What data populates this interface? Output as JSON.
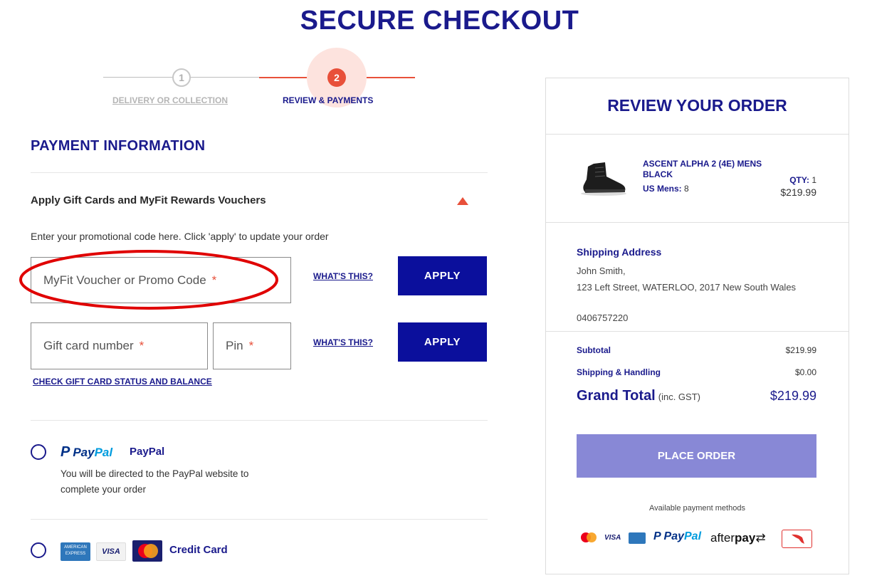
{
  "page": {
    "title": "SECURE CHECKOUT"
  },
  "stepper": {
    "step1": {
      "number": "1",
      "label": "DELIVERY OR COLLECTION"
    },
    "step2": {
      "number": "2",
      "label": "REVIEW & PAYMENTS"
    }
  },
  "payment": {
    "title": "PAYMENT INFORMATION",
    "gift_section_title": "Apply Gift Cards and MyFit Rewards Vouchers",
    "instructions": "Enter your promotional code here. Click 'apply' to update your order",
    "promo_placeholder": "MyFit Voucher or Promo Code",
    "gift_placeholder": "Gift card number",
    "pin_placeholder": "Pin",
    "required_mark": "*",
    "whats_this": "WHAT'S THIS?",
    "apply_label": "APPLY",
    "gift_status_link": "CHECK GIFT CARD STATUS AND BALANCE",
    "paypal": {
      "logo_p": "P",
      "logo_pay": "Pay",
      "logo_pal": "Pal",
      "title": "PayPal",
      "description": "You will be directed to the PayPal website to complete your order"
    },
    "credit_card": {
      "title": "Credit Card",
      "amex_text": "AMERICAN EXPRESS",
      "visa_text": "VISA"
    }
  },
  "order": {
    "title": "REVIEW YOUR ORDER",
    "product": {
      "name": "ASCENT ALPHA 2 (4E) MENS BLACK",
      "size_label": "US Mens:",
      "size_value": "8",
      "qty_label": "QTY:",
      "qty_value": "1",
      "price": "$219.99"
    },
    "shipping": {
      "title": "Shipping Address",
      "name": "John Smith,",
      "address": "123 Left Street, WATERLOO, 2017 New South Wales",
      "phone": "0406757220"
    },
    "summary": {
      "subtotal_label": "Subtotal",
      "subtotal_value": "$219.99",
      "shipping_label": "Shipping & Handling",
      "shipping_value": "$0.00",
      "grand_label": "Grand Total",
      "grand_note": "(inc. GST)",
      "grand_value": "$219.99"
    },
    "place_order_label": "PLACE ORDER",
    "available_methods_text": "Available payment methods",
    "methods": {
      "visa": "VISA",
      "paypal_pay": "Pay",
      "paypal_pal": "Pal",
      "afterpay_after": "after",
      "afterpay_pay": "pay"
    }
  },
  "colors": {
    "brand_navy": "#1a1a8c",
    "accent_red": "#e8503a",
    "apply_blue": "#0b0f9c",
    "place_order": "#8888d6"
  }
}
